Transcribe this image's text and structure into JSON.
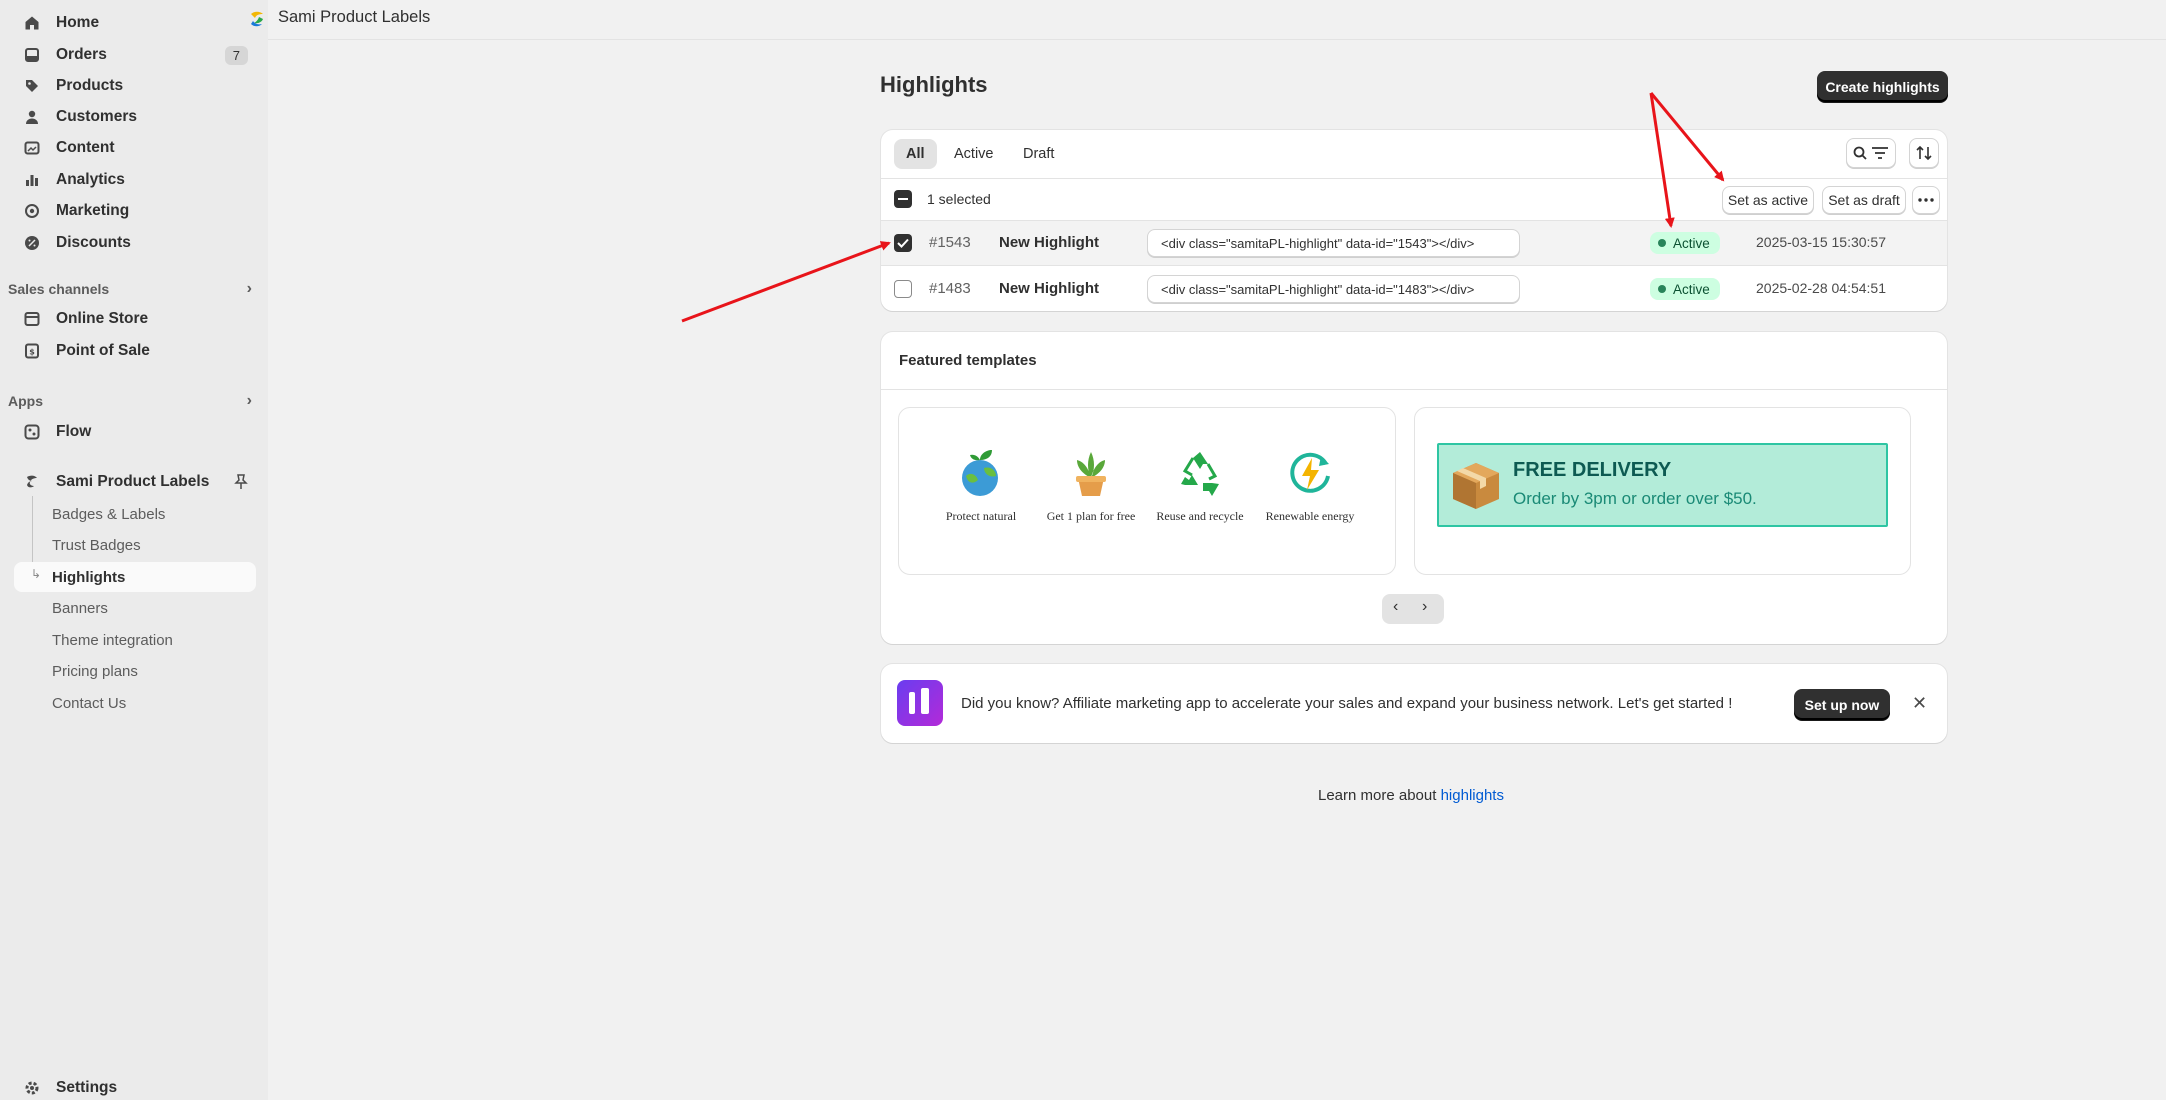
{
  "sidebar": {
    "items": [
      {
        "label": "Home",
        "icon": "home-icon"
      },
      {
        "label": "Orders",
        "icon": "orders-icon",
        "badge": "7"
      },
      {
        "label": "Products",
        "icon": "tag-icon"
      },
      {
        "label": "Customers",
        "icon": "person-icon"
      },
      {
        "label": "Content",
        "icon": "content-icon"
      },
      {
        "label": "Analytics",
        "icon": "bar-chart-icon"
      },
      {
        "label": "Marketing",
        "icon": "target-icon"
      },
      {
        "label": "Discounts",
        "icon": "discount-icon"
      }
    ],
    "sales_channels": {
      "heading": "Sales channels",
      "items": [
        {
          "label": "Online Store",
          "icon": "store-icon"
        },
        {
          "label": "Point of Sale",
          "icon": "pos-icon"
        }
      ]
    },
    "apps": {
      "heading": "Apps",
      "items": [
        {
          "label": "Flow",
          "icon": "flow-icon"
        }
      ]
    },
    "app": {
      "label": "Sami Product Labels",
      "sub_items": [
        "Badges & Labels",
        "Trust Badges",
        "Highlights",
        "Banners",
        "Theme integration",
        "Pricing plans",
        "Contact Us"
      ]
    },
    "settings": {
      "label": "Settings",
      "icon": "gear-icon"
    }
  },
  "topbar": {
    "app_title": "Sami Product Labels"
  },
  "page": {
    "title": "Highlights",
    "create_button": "Create highlights"
  },
  "tabs": [
    "All",
    "Active",
    "Draft"
  ],
  "bulk": {
    "selected_text": "1 selected",
    "set_active": "Set as active",
    "set_draft": "Set as draft"
  },
  "rows": [
    {
      "id": "#1543",
      "name": "New Highlight",
      "code": "<div class=\"samitaPL-highlight\" data-id=\"1543\"></div>",
      "status": "Active",
      "date": "2025-03-15 15:30:57",
      "checked": true
    },
    {
      "id": "#1483",
      "name": "New Highlight",
      "code": "<div class=\"samitaPL-highlight\" data-id=\"1483\"></div>",
      "status": "Active",
      "date": "2025-02-28 04:54:51",
      "checked": false
    }
  ],
  "featured": {
    "heading": "Featured templates",
    "items": [
      {
        "label": "Protect natural",
        "icon": "earth-plant-icon"
      },
      {
        "label": "Get 1 plan for free",
        "icon": "potted-plant-icon"
      },
      {
        "label": "Reuse and recycle",
        "icon": "recycle-icon"
      },
      {
        "label": "Renewable energy",
        "icon": "energy-icon"
      }
    ],
    "delivery_title": "FREE DELIVERY",
    "delivery_subtitle": "Order by 3pm or order over $50."
  },
  "promo": {
    "text": "Did you know? Affiliate marketing app to accelerate your sales and expand your business network. Let's get started !",
    "button": "Set up now"
  },
  "footer": {
    "prefix": "Learn more about ",
    "link": "highlights"
  },
  "colors": {
    "accent": "#303030",
    "status_bg": "#cdfee1",
    "link": "#005bd3",
    "annotation": "#e8141a"
  }
}
